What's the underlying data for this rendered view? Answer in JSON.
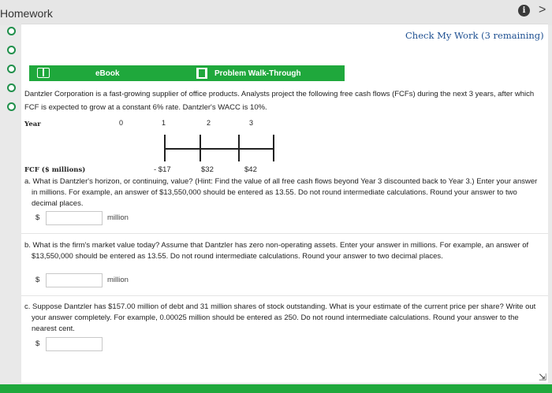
{
  "header": {
    "title": "Homework",
    "info_icon": "i",
    "next_icon": ">"
  },
  "left_rail": {
    "radio_count": 5
  },
  "card": {
    "check_work": "Check My Work (3 remaining)",
    "buttons": {
      "ebook": "eBook",
      "walkthrough": "Problem Walk-Through"
    },
    "intro": "Dantzler Corporation is a fast-growing supplier of office products. Analysts project the following free cash flows (FCFs) during the next 3 years, after which FCF is expected to grow at a constant 6% rate. Dantzler's WACC is 10%.",
    "timeline": {
      "year_label": "Year",
      "years": [
        "0",
        "1",
        "2",
        "3"
      ],
      "fcf_label": "FCF ($ millions)",
      "fcf_values": [
        "- $17",
        "$32",
        "$42"
      ]
    },
    "questions": [
      {
        "text": "a.  What is Dantzler's horizon, or continuing, value? (Hint: Find the value of all free cash flows beyond Year 3 discounted back to Year 3.) Enter your answer in millions. For example, an answer of $13,550,000 should be entered as 13.55. Do not round intermediate calculations. Round your answer to two decimal places.",
        "currency": "$",
        "value": "",
        "unit": "million"
      },
      {
        "text": "b.  What is the firm's market value today? Assume that Dantzler has zero non-operating assets. Enter your answer in millions. For example, an answer of $13,550,000 should be entered as 13.55. Do not round intermediate calculations. Round your answer to two decimal places.",
        "currency": "$",
        "value": "",
        "unit": "million"
      },
      {
        "text": "c.  Suppose Dantzler has $157.00 million of debt and 31 million shares of stock outstanding. What is your estimate of the current price per share? Write out your answer completely. For example, 0.00025 million should be entered as 250. Do not round intermediate calculations. Round your answer to the nearest cent.",
        "currency": "$",
        "value": "",
        "unit": ""
      }
    ]
  },
  "colors": {
    "accent": "#1fa83c",
    "link": "#1d4f91",
    "radio": "#1f8f4a"
  }
}
